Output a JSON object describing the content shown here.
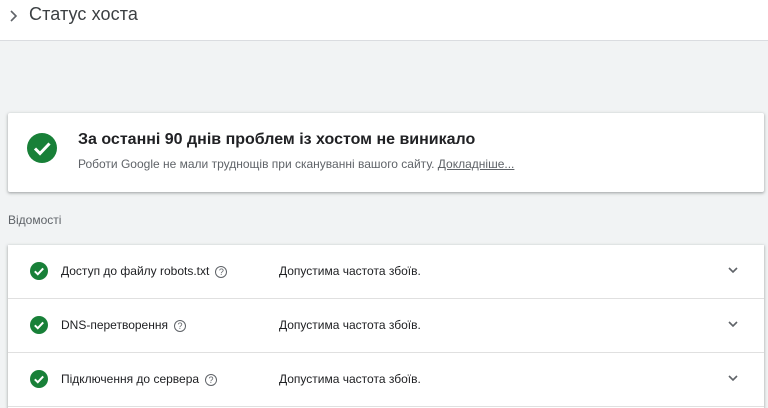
{
  "header": {
    "title": "Статус хоста",
    "back_icon": "chevron-right-icon"
  },
  "summary": {
    "headline": "За останні 90 днів проблем із хостом не виникало",
    "description": "Роботи Google не мали труднощів при скануванні вашого сайту.",
    "link": "Докладніше...",
    "icon": "check-circle-icon",
    "icon_color": "#188038"
  },
  "details": {
    "label": "Відомості",
    "rows": [
      {
        "name": "Доступ до файлу robots.txt",
        "status": "Допустима частота збоїв."
      },
      {
        "name": "DNS-перетворення",
        "status": "Допустима частота збоїв."
      },
      {
        "name": "Підключення до сервера",
        "status": "Допустима частота збоїв."
      }
    ]
  }
}
